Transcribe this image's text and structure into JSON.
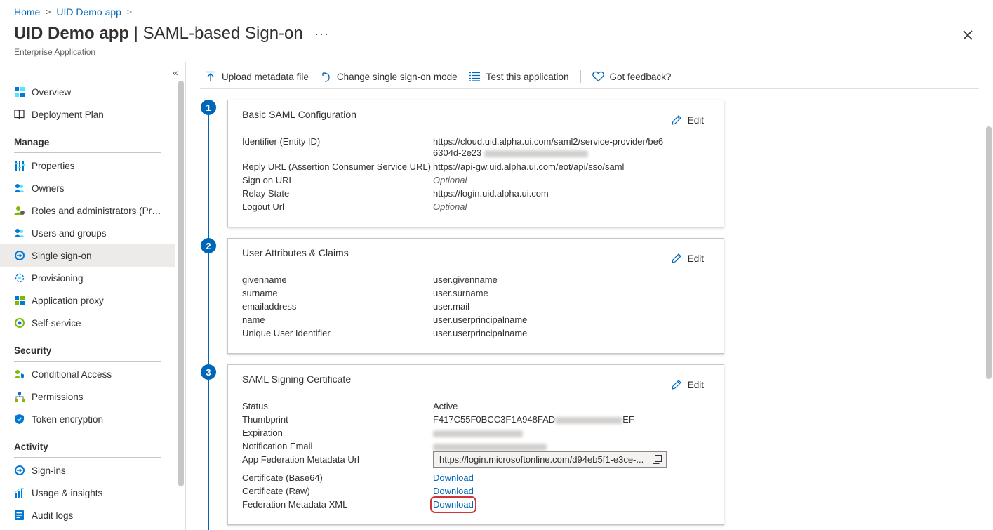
{
  "breadcrumb": {
    "home": "Home",
    "app": "UID Demo app"
  },
  "header": {
    "app_title": "UID Demo app",
    "pipe": " | ",
    "section_title": "SAML-based Sign-on",
    "more": "···",
    "subtitle": "Enterprise Application"
  },
  "sidebar": {
    "collapse": "«",
    "items_top": [
      {
        "label": "Overview"
      },
      {
        "label": "Deployment Plan"
      }
    ],
    "groups": [
      {
        "heading": "Manage",
        "items": [
          {
            "label": "Properties"
          },
          {
            "label": "Owners"
          },
          {
            "label": "Roles and administrators (Preview)"
          },
          {
            "label": "Users and groups"
          },
          {
            "label": "Single sign-on"
          },
          {
            "label": "Provisioning"
          },
          {
            "label": "Application proxy"
          },
          {
            "label": "Self-service"
          }
        ]
      },
      {
        "heading": "Security",
        "items": [
          {
            "label": "Conditional Access"
          },
          {
            "label": "Permissions"
          },
          {
            "label": "Token encryption"
          }
        ]
      },
      {
        "heading": "Activity",
        "items": [
          {
            "label": "Sign-ins"
          },
          {
            "label": "Usage & insights"
          },
          {
            "label": "Audit logs"
          }
        ]
      }
    ]
  },
  "toolbar": {
    "upload": "Upload metadata file",
    "change_mode": "Change single sign-on mode",
    "test": "Test this application",
    "feedback": "Got feedback?"
  },
  "steps": [
    "1",
    "2",
    "3"
  ],
  "edit_label": "Edit",
  "basic_saml": {
    "title": "Basic SAML Configuration",
    "rows": [
      {
        "key": "Identifier (Entity ID)",
        "value": "https://cloud.uid.alpha.ui.com/saml2/service-provider/be6",
        "value2": "6304d-2e23"
      },
      {
        "key": "Reply URL (Assertion Consumer Service URL)",
        "value": "https://api-gw.uid.alpha.ui.com/eot/api/sso/saml"
      },
      {
        "key": "Sign on URL",
        "value": "Optional"
      },
      {
        "key": "Relay State",
        "value": "https://login.uid.alpha.ui.com"
      },
      {
        "key": "Logout Url",
        "value": "Optional"
      }
    ]
  },
  "claims": {
    "title": "User Attributes & Claims",
    "rows": [
      {
        "key": "givenname",
        "value": "user.givenname"
      },
      {
        "key": "surname",
        "value": "user.surname"
      },
      {
        "key": "emailaddress",
        "value": "user.mail"
      },
      {
        "key": "name",
        "value": "user.userprincipalname"
      },
      {
        "key": "Unique User Identifier",
        "value": "user.userprincipalname"
      }
    ]
  },
  "certificate": {
    "title": "SAML Signing Certificate",
    "status_key": "Status",
    "status_value": "Active",
    "thumbprint_key": "Thumbprint",
    "thumbprint_start": "F417C55F0BCC3F1A948FAD",
    "thumbprint_end": "EF",
    "expiration_key": "Expiration",
    "notification_key": "Notification Email",
    "metadata_url_key": "App Federation Metadata Url",
    "metadata_url_value": "https://login.microsoftonline.com/d94eb5f1-e3ce-...",
    "base64_key": "Certificate (Base64)",
    "raw_key": "Certificate (Raw)",
    "xml_key": "Federation Metadata XML",
    "download": "Download"
  },
  "colors": {
    "accent": "#0067b8",
    "highlight": "#d13438",
    "active_nav": "#edebe9"
  }
}
